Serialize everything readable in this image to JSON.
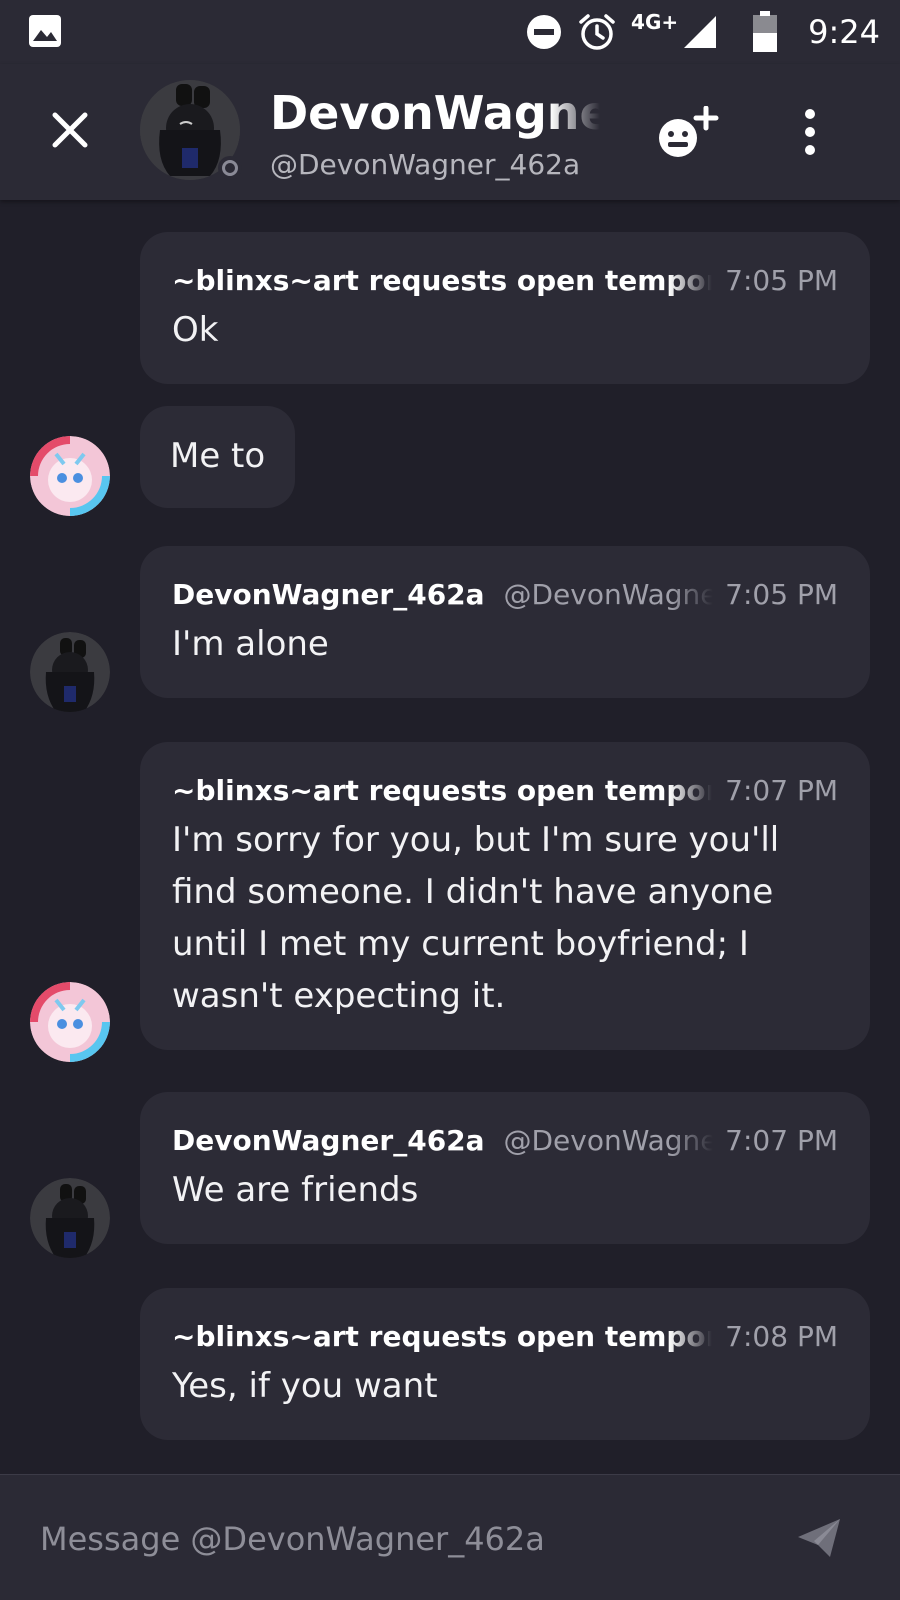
{
  "status_bar": {
    "network": "4G+",
    "time": "9:24",
    "icons": [
      "gallery-icon",
      "do-not-disturb-icon",
      "alarm-icon",
      "signal-icon",
      "battery-icon"
    ]
  },
  "header": {
    "name": "DevonWagner",
    "handle": "@DevonWagner_462a",
    "icons": [
      "close-icon",
      "add-friend-icon",
      "more-vert-icon"
    ]
  },
  "messages": [
    {
      "author": "~blinxs~art requests open tempora",
      "handle": "",
      "time": "7:05 PM",
      "text": "Ok"
    },
    {
      "author": "",
      "handle": "",
      "time": "",
      "text": "Me to"
    },
    {
      "author": "DevonWagner_462a",
      "handle": "@DevonWagner",
      "time": "7:05 PM",
      "text": "I'm alone"
    },
    {
      "author": "~blinxs~art requests open tempora",
      "handle": "",
      "time": "7:07 PM",
      "text": "I'm sorry for you, but I'm sure you'll find someone. I didn't have anyone until I met my current boyfriend; I wasn't expecting it."
    },
    {
      "author": "DevonWagner_462a",
      "handle": "@DevonWagner",
      "time": "7:07 PM",
      "text": "We are friends"
    },
    {
      "author": "~blinxs~art requests open tempora",
      "handle": "",
      "time": "7:08 PM",
      "text": "Yes, if you want"
    }
  ],
  "composer": {
    "placeholder": "Message @DevonWagner_462a",
    "icons": [
      "send-icon"
    ]
  },
  "colors": {
    "background": "#201f29",
    "bar": "#2b2a35",
    "bubble": "#2c2b36",
    "muted_text": "#a0a0aa"
  }
}
